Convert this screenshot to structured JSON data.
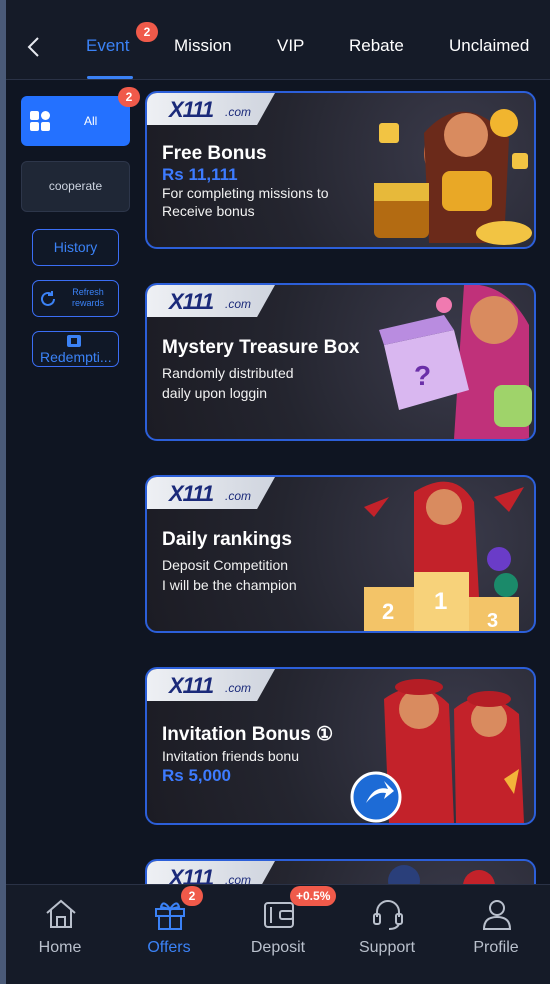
{
  "top_tabs": [
    {
      "label": "Event",
      "active": true,
      "badge": "2"
    },
    {
      "label": "Mission"
    },
    {
      "label": "VIP"
    },
    {
      "label": "Rebate"
    },
    {
      "label": "Unclaimed"
    }
  ],
  "side_menu": {
    "all_label": "All",
    "all_badge": "2",
    "cooperate_label": "cooperate",
    "history_label": "History",
    "refresh_label": "Refresh rewards",
    "redemption_label": "Redempti..."
  },
  "banners": [
    {
      "brand": "X111",
      "domain": ".com",
      "title": "Free Bonus",
      "amount": "Rs 11,111",
      "subtitle": [
        "For completing missions to",
        "Receive bonus"
      ]
    },
    {
      "brand": "X111",
      "domain": ".com",
      "title": "Mystery Treasure Box",
      "subtitle": [
        "Randomly distributed",
        "daily upon loggin"
      ]
    },
    {
      "brand": "X111",
      "domain": ".com",
      "title": "Daily rankings",
      "subtitle": [
        "Deposit Competition",
        "I will be the champion"
      ],
      "podium": [
        "2",
        "1",
        "3"
      ]
    },
    {
      "brand": "X111",
      "domain": ".com",
      "title": "Invitation Bonus",
      "title_mark": "①",
      "subtitle": [
        "Invitation friends bonu"
      ],
      "amount": "Rs 5,000"
    },
    {
      "brand": "X111",
      "domain": ".com"
    }
  ],
  "bottom_nav": [
    {
      "label": "Home",
      "icon": "home-icon"
    },
    {
      "label": "Offers",
      "icon": "gift-icon",
      "active": true,
      "badge": "2"
    },
    {
      "label": "Deposit",
      "icon": "wallet-icon",
      "badge": "+0.5%"
    },
    {
      "label": "Support",
      "icon": "headset-icon"
    },
    {
      "label": "Profile",
      "icon": "user-icon"
    }
  ],
  "colors": {
    "accent": "#3b82f6",
    "badge": "#f05a4a",
    "background": "#0f1522"
  }
}
